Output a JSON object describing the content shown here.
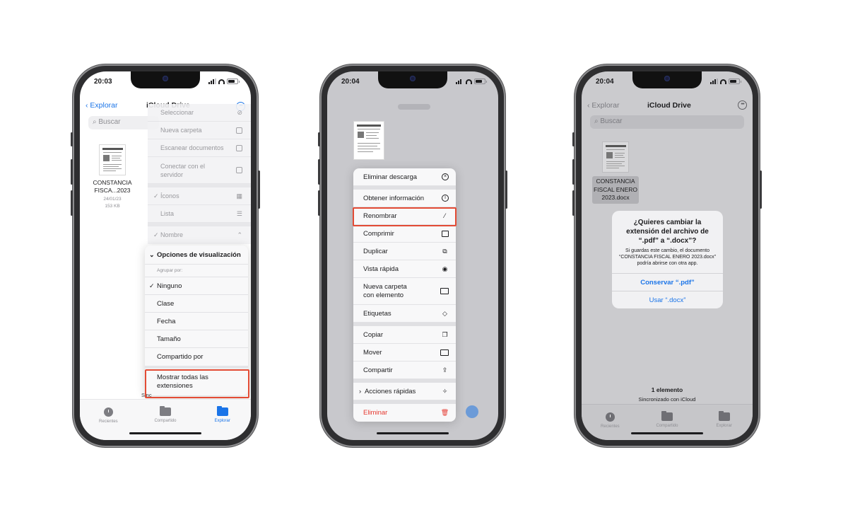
{
  "phone1": {
    "status_time": "20:03",
    "nav": {
      "back": "Explorar",
      "title": "iCloud Drive"
    },
    "search_placeholder": "Buscar",
    "file": {
      "name": "CONSTANCIA FISCA...2023",
      "date": "24/01/23",
      "size": "153 KB"
    },
    "back_menu": [
      "Seleccionar",
      "Nueva carpeta",
      "Escanear documentos",
      "Conectar con el servidor",
      "Íconos",
      "Lista",
      "Nombre"
    ],
    "back_menu_checked": [
      "Íconos",
      "Nombre"
    ],
    "view_menu": {
      "title": "Opciones de visualización",
      "group_label": "Agrupar por:",
      "items": [
        "Ninguno",
        "Clase",
        "Fecha",
        "Tamaño",
        "Compartido por"
      ],
      "checked": "Ninguno",
      "highlight": "Mostrar todas las extensiones"
    },
    "sync_partial": "Sinc",
    "tabs": [
      "Recientes",
      "Compartido",
      "Explorar"
    ],
    "active_tab": "Explorar"
  },
  "phone2": {
    "status_time": "20:04",
    "menu": [
      [
        "Eliminar descarga"
      ],
      [
        "Obtener información",
        "Renombrar",
        "Comprimir",
        "Duplicar",
        "Vista rápida",
        "Nueva carpeta con elemento",
        "Etiquetas"
      ],
      [
        "Copiar",
        "Mover",
        "Compartir"
      ],
      [
        "Acciones rápidas"
      ],
      [
        "Eliminar"
      ]
    ],
    "highlight": "Renombrar",
    "destructive": "Eliminar"
  },
  "phone3": {
    "status_time": "20:04",
    "nav": {
      "back": "Explorar",
      "title": "iCloud Drive"
    },
    "search_placeholder": "Buscar",
    "file_name": "CONSTANCIA FISCAL ENERO 2023.docx",
    "alert": {
      "title": "¿Quieres cambiar la extensión del archivo de “.pdf” a “.docx”?",
      "message": "Si guardas este cambio, el documento “CONSTANCIA FISCAL ENERO 2023.docx” podría abrirse con otra app.",
      "keep": "Conservar “.pdf”",
      "use": "Usar “.docx”"
    },
    "count": "1 elemento",
    "sync": "Sincronizado con iCloud",
    "tabs": [
      "Recientes",
      "Compartido",
      "Explorar"
    ]
  },
  "accent_color": "#1a74e8",
  "highlight_color": "#e34b35"
}
